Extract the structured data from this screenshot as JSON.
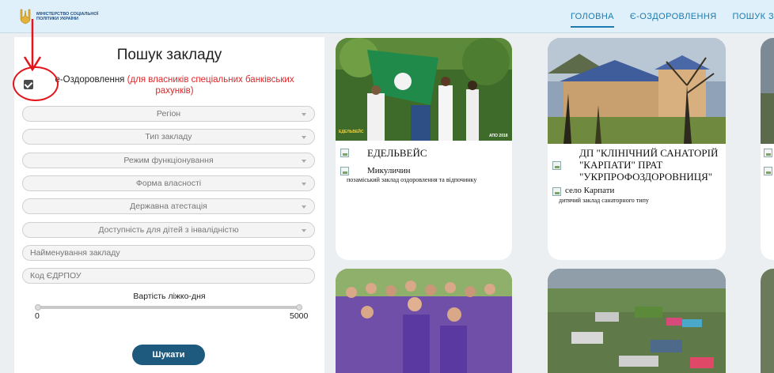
{
  "header": {
    "logo_text": "МІНІСТЕРСТВО СОЦІАЛЬНОЇ ПОЛІТИКИ УКРАЇНИ",
    "nav": [
      {
        "label": "ГОЛОВНА"
      },
      {
        "label": "Є-ОЗДОРОВЛЕННЯ"
      },
      {
        "label": "ПОШУК З"
      }
    ]
  },
  "search": {
    "title": "Пошук закладу",
    "eo_checkbox_label": "е-Оздоровлення",
    "eo_note": "(для власників спеціальних банківських рахунків)",
    "filters": {
      "region": "Регіон",
      "type": "Тип закладу",
      "mode": "Режим функціонування",
      "ownership": "Форма власності",
      "attestation": "Державна атестація",
      "accessibility": "Доступність для дітей з інвалідністю"
    },
    "name_placeholder": "Найменування закладу",
    "edrpou_placeholder": "Код ЄДРПОУ",
    "price_label": "Вартість ліжко-дня",
    "price_min": "0",
    "price_max": "5000",
    "search_button": "Шукати"
  },
  "cards": [
    {
      "name": "ЕДЕЛЬВЕЙС",
      "place": "Микуличин",
      "type": "позаміський заклад оздоровлення та відпочинку",
      "photo_logo": "ЕДЕЛЬВЕЙС",
      "photo_caption": "АПО 2018"
    },
    {
      "name": "ДП \"КЛІНІЧНИЙ САНАТОРІЙ \"КАРПАТИ\" ПРАТ \"УКРПРОФОЗДОРОВНИЦЯ\"",
      "place": "село Карпати",
      "type": "дитячий заклад санаторного типу"
    }
  ],
  "colors": {
    "header_bg": "#dff0fa",
    "nav_text": "#1b7bb0",
    "note_red": "#e0262a",
    "button_bg": "#1e5a7e",
    "annotation_red": "#e3141a"
  }
}
